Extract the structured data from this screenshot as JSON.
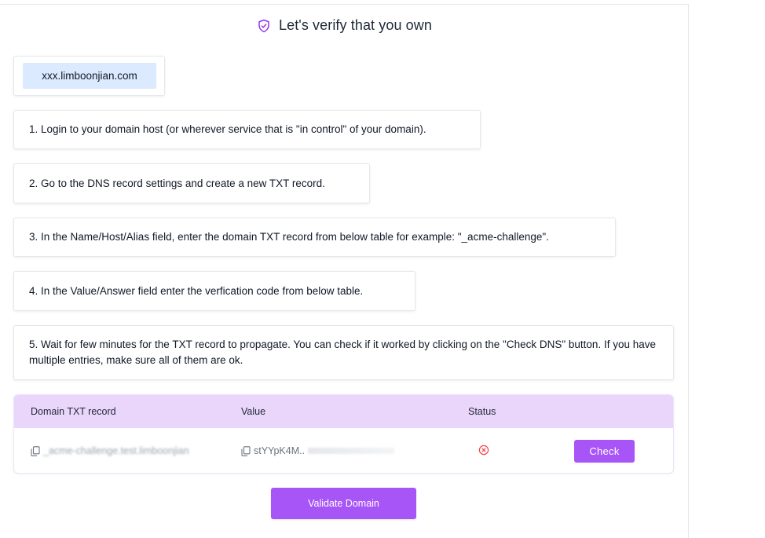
{
  "header": {
    "title": "Let's verify that you own",
    "icon": "shield-check-icon",
    "accent": "#9333ea"
  },
  "domain": "xxx.limboonjian.com",
  "steps": [
    "1. Login to your domain host (or wherever service that is \"in control\" of your domain).",
    "2. Go to the DNS record settings and create a new TXT record.",
    "3. In the Name/Host/Alias field, enter the domain TXT record from below table for example: \"_acme-challenge\".",
    "4. In the Value/Answer field enter the verfication code from below table.",
    "5. Wait for few minutes for the TXT record to propagate. You can check if it worked by clicking on the \"Check DNS\" button. If you have multiple entries, make sure all of them are ok."
  ],
  "table": {
    "columns": [
      "Domain TXT record",
      "Value",
      "Status"
    ],
    "rows": [
      {
        "record": "_acme-challenge.test.limboonjian",
        "value": "stYYpK4M..",
        "status_icon": "error-circle-icon",
        "check_label": "Check"
      }
    ],
    "header_bg": "#ead5fb"
  },
  "validate_label": "Validate Domain",
  "colors": {
    "primary": "#a855f7",
    "chip": "#dbeafe",
    "error": "#ef4444"
  }
}
